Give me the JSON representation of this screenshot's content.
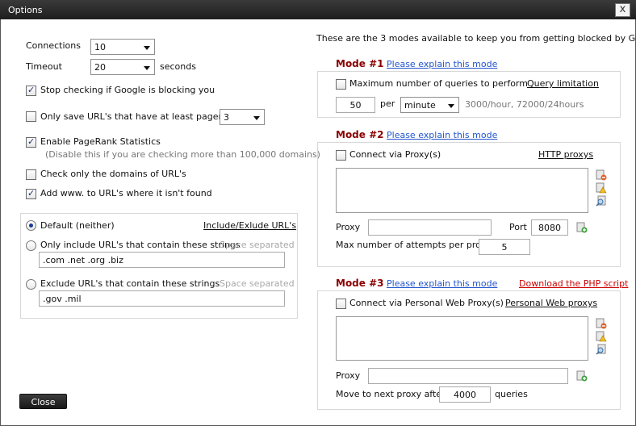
{
  "window": {
    "title": "Options",
    "close_glyph": "x"
  },
  "left": {
    "connections": {
      "label": "Connections",
      "value": "10"
    },
    "timeout": {
      "label": "Timeout",
      "value": "20",
      "unit": "seconds"
    },
    "stop_checking": {
      "label": "Stop checking if Google is blocking you",
      "checked": true
    },
    "only_save": {
      "label": "Only save URL's that have at least pagerank",
      "checked": false,
      "value": "3"
    },
    "pagerank_stats": {
      "label": "Enable PageRank Statistics",
      "note": "(Disable this if you are checking more than 100,000 domains)",
      "checked": true
    },
    "check_domains": {
      "label": "Check only the domains of URL's",
      "checked": false
    },
    "add_www": {
      "label": "Add www. to URL's where it isn't found",
      "checked": true
    },
    "filter": {
      "default_label": "Default (neither)",
      "include_exclude_link": "Include/Exlude URL's",
      "include_label": "Only include URL's that contain these strings",
      "include_hint": "Space separated",
      "include_value": ".com .net .org .biz",
      "exclude_label": "Exclude URL's that contain these strings",
      "exclude_hint": "Space separated",
      "exclude_value": ".gov .mil",
      "selected": "default"
    },
    "close_label": "Close"
  },
  "right": {
    "intro": "These are the 3 modes available to keep you from getting blocked by Google.",
    "mode1": {
      "title": "Mode #1",
      "explain": "Please explain this mode",
      "checkbox_label": "Maximum number of queries to perform",
      "checked": false,
      "link": "Query limitation",
      "value": "50",
      "per": "per",
      "unit": "minute",
      "rate_note": "3000/hour, 72000/24hours"
    },
    "mode2": {
      "title": "Mode #2",
      "explain": "Please explain this mode",
      "checkbox_label": "Connect via Proxy(s)",
      "checked": false,
      "link": "HTTP proxys",
      "proxy_label": "Proxy",
      "proxy_value": "",
      "port_label": "Port",
      "port_value": "8080",
      "attempts_label": "Max number of attempts per proxy",
      "attempts_value": "5"
    },
    "mode3": {
      "title": "Mode #3",
      "explain": "Please explain this mode",
      "download_link": "Download the PHP script",
      "checkbox_label": "Connect via Personal Web Proxy(s)",
      "checked": false,
      "link": "Personal Web proxys",
      "proxy_label": "Proxy",
      "proxy_value": "",
      "move_label": "Move to next proxy after",
      "move_value": "4000",
      "move_unit": "queries"
    }
  },
  "colors": {
    "mode_title": "#8b0000",
    "link": "#2255cc",
    "download": "#cc0000",
    "titlebar": "#2a2a2a"
  }
}
